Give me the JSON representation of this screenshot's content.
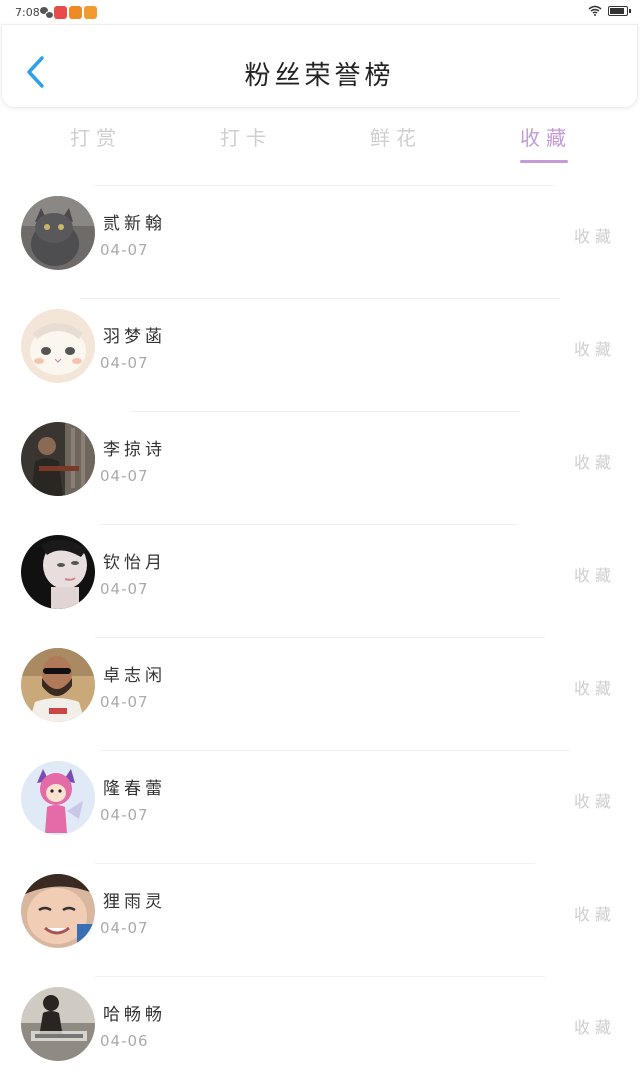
{
  "status_bar": {
    "time": "7:08"
  },
  "header": {
    "title": "粉丝荣誉榜"
  },
  "tabs": [
    {
      "label": "打赏",
      "active": false
    },
    {
      "label": "打卡",
      "active": false
    },
    {
      "label": "鲜花",
      "active": false
    },
    {
      "label": "收藏",
      "active": true
    }
  ],
  "colors": {
    "accent": "#c49ad9",
    "back_arrow": "#2aa3e8",
    "muted": "#cfcfcf"
  },
  "fans": [
    {
      "name": "贰新翰",
      "date": "04-07",
      "action": "收藏",
      "avatar": "gray-cat"
    },
    {
      "name": "羽梦菡",
      "date": "04-07",
      "action": "收藏",
      "avatar": "white-cat-illustration"
    },
    {
      "name": "李掠诗",
      "date": "04-07",
      "action": "收藏",
      "avatar": "man-with-gun"
    },
    {
      "name": "钦怡月",
      "date": "04-07",
      "action": "收藏",
      "avatar": "woman-portrait"
    },
    {
      "name": "卓志闲",
      "date": "04-07",
      "action": "收藏",
      "avatar": "bearded-man-sunglasses"
    },
    {
      "name": "隆春蕾",
      "date": "04-07",
      "action": "收藏",
      "avatar": "cartoon-girl-cat-ears"
    },
    {
      "name": "狸雨灵",
      "date": "04-07",
      "action": "收藏",
      "avatar": "child-face"
    },
    {
      "name": "哈畅畅",
      "date": "04-06",
      "action": "收藏",
      "avatar": "person-photo"
    }
  ]
}
